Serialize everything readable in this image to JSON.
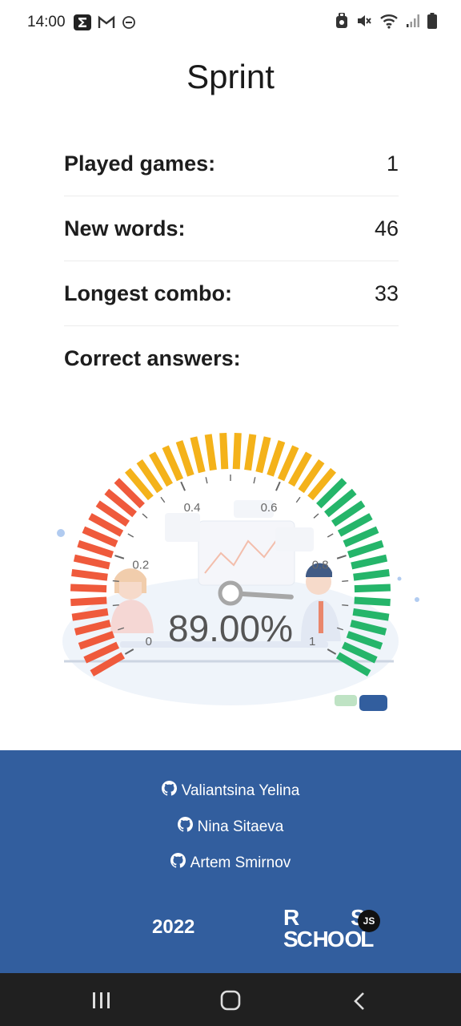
{
  "status_bar": {
    "time": "14:00",
    "left_icons": [
      "sigma-icon",
      "gmail-icon",
      "do-not-disturb-icon"
    ],
    "right_icons": [
      "sos-icon",
      "mute-icon",
      "wifi-icon",
      "signal-icon",
      "battery-icon"
    ]
  },
  "page": {
    "title": "Sprint"
  },
  "stats": [
    {
      "label": "Played games:",
      "value": "1"
    },
    {
      "label": "New words:",
      "value": "46"
    },
    {
      "label": "Longest combo:",
      "value": "33"
    },
    {
      "label": "Correct answers:",
      "value": ""
    }
  ],
  "gauge": {
    "value": 0.89,
    "display": "89.00%",
    "tick_labels": [
      "0",
      "0.2",
      "0.4",
      "0.6",
      "0.8",
      "1"
    ],
    "colors": {
      "low": "#ef5a3c",
      "mid": "#f4b21a",
      "high": "#25b56a",
      "text": "#555555"
    }
  },
  "carousel": {
    "dots": 2,
    "active": 1
  },
  "footer": {
    "authors": [
      "Valiantsina Yelina",
      "Nina Sitaeva",
      "Artem Smirnov"
    ],
    "year": "2022",
    "logo_lines": [
      "R S",
      "SC HO OL"
    ],
    "logo_badge": "JS",
    "background": "#325e9e"
  },
  "nav_bar": {
    "buttons": [
      "recents-button",
      "home-button",
      "back-button"
    ]
  }
}
